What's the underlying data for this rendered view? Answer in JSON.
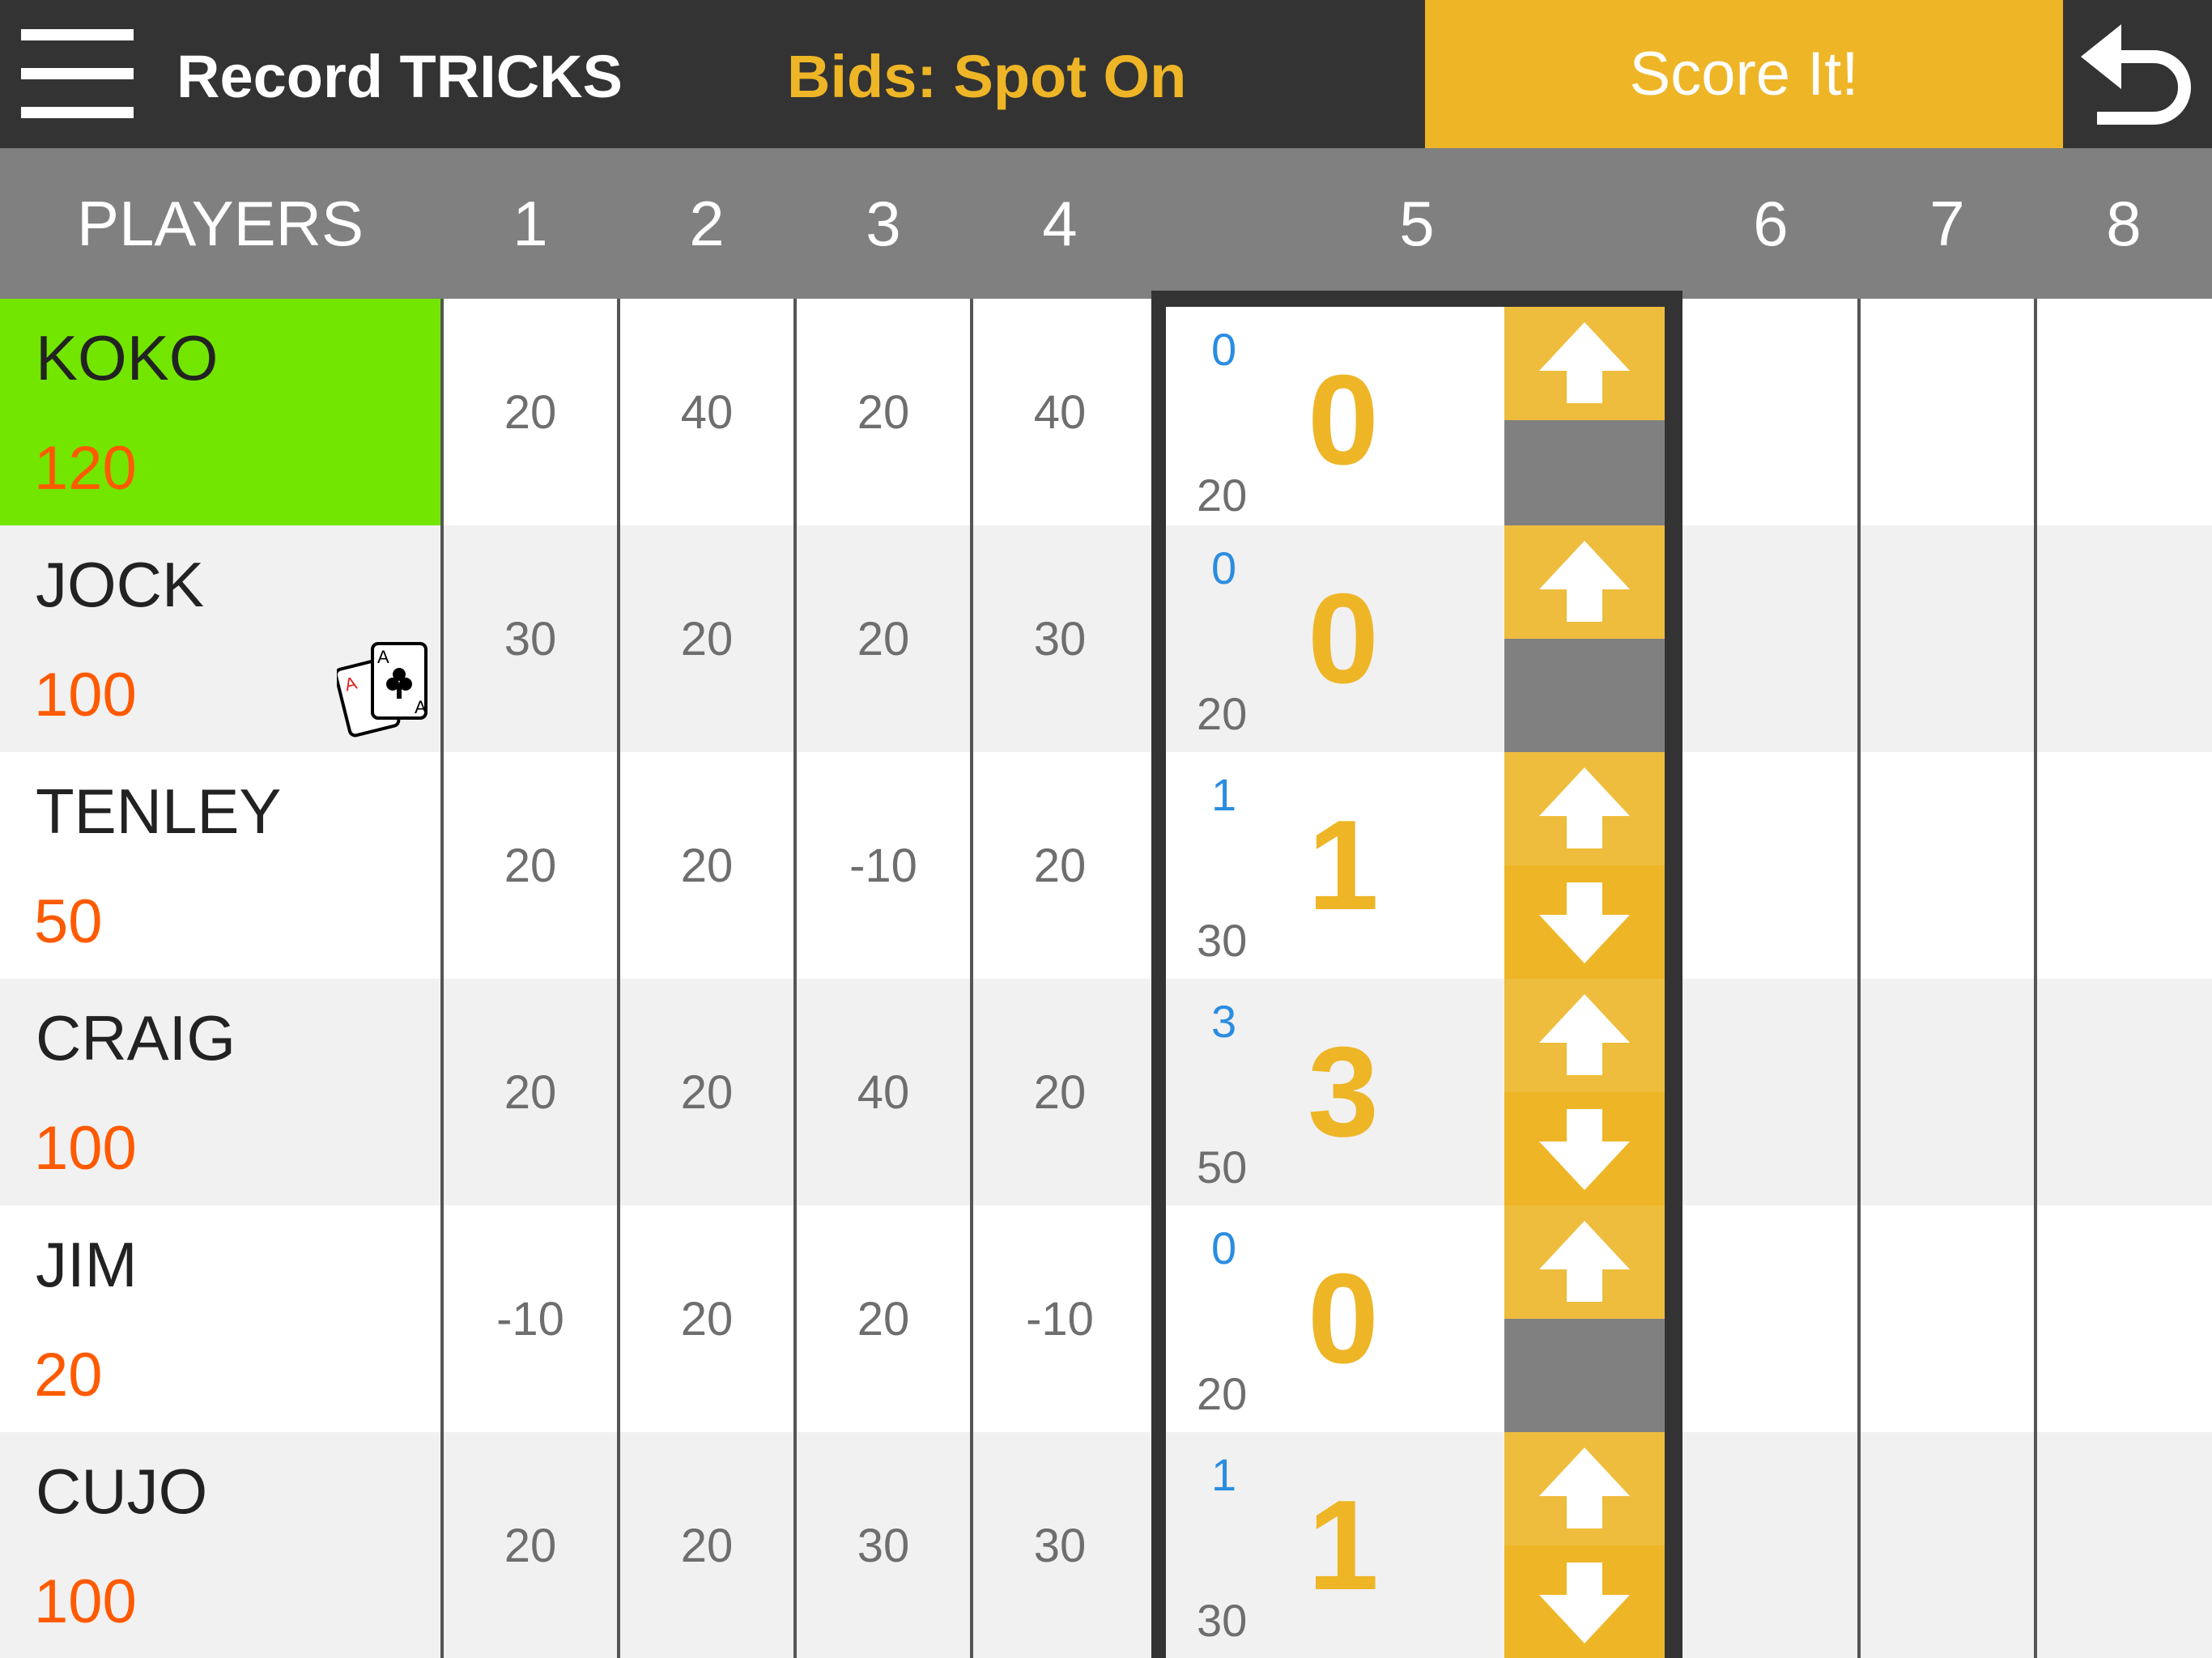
{
  "topbar": {
    "title": "Record TRICKS",
    "bids_status": "Bids: Spot On",
    "score_button": "Score It!",
    "undo_icon": "undo-arrow-icon",
    "menu_icon": "hamburger-menu-icon"
  },
  "header": {
    "players_label": "PLAYERS",
    "rounds": [
      "1",
      "2",
      "3",
      "4",
      "5",
      "6",
      "7",
      "8"
    ],
    "active_round": "5"
  },
  "colors": {
    "topbar_bg": "#333333",
    "accent": "#eeb526",
    "header_bg": "#808080",
    "leader_bg": "#73e600",
    "total_color": "#ff5a00",
    "bid_color": "#2b8de0"
  },
  "players": [
    {
      "name": "KOKO",
      "total": "120",
      "leader": true,
      "dealer": false,
      "scores": [
        "20",
        "40",
        "20",
        "40"
      ],
      "current": {
        "bid": "0",
        "tricks": "0",
        "points": "20",
        "can_decrease": false
      }
    },
    {
      "name": "JOCK",
      "total": "100",
      "leader": false,
      "dealer": true,
      "scores": [
        "30",
        "20",
        "20",
        "30"
      ],
      "current": {
        "bid": "0",
        "tricks": "0",
        "points": "20",
        "can_decrease": false
      }
    },
    {
      "name": "TENLEY",
      "total": "50",
      "leader": false,
      "dealer": false,
      "scores": [
        "20",
        "20",
        "-10",
        "20"
      ],
      "current": {
        "bid": "1",
        "tricks": "1",
        "points": "30",
        "can_decrease": true
      }
    },
    {
      "name": "CRAIG",
      "total": "100",
      "leader": false,
      "dealer": false,
      "scores": [
        "20",
        "20",
        "40",
        "20"
      ],
      "current": {
        "bid": "3",
        "tricks": "3",
        "points": "50",
        "can_decrease": true
      }
    },
    {
      "name": "JIM",
      "total": "20",
      "leader": false,
      "dealer": false,
      "scores": [
        "-10",
        "20",
        "20",
        "-10"
      ],
      "current": {
        "bid": "0",
        "tricks": "0",
        "points": "20",
        "can_decrease": false
      }
    },
    {
      "name": "CUJO",
      "total": "100",
      "leader": false,
      "dealer": false,
      "scores": [
        "20",
        "20",
        "30",
        "30"
      ],
      "current": {
        "bid": "1",
        "tricks": "1",
        "points": "30",
        "can_decrease": true
      }
    }
  ],
  "dealer_icon": {
    "name": "dealer-cards-icon",
    "card_letter": "A"
  }
}
